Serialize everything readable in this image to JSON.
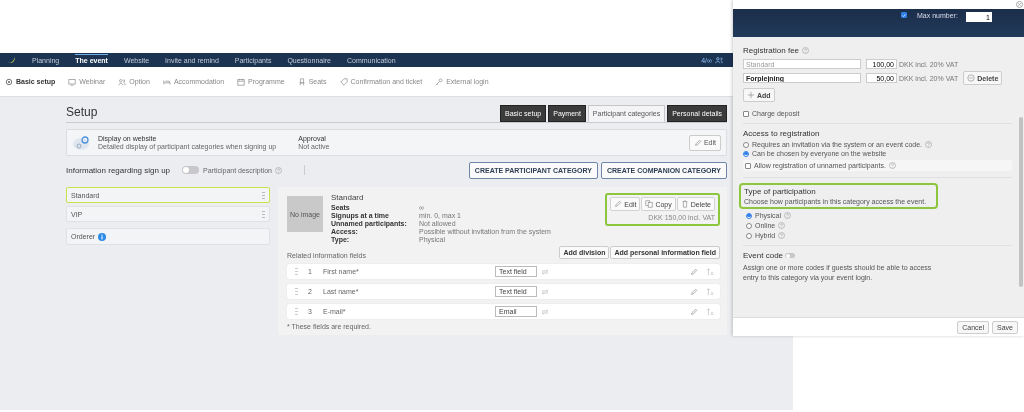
{
  "app": {
    "nav": {
      "items": [
        {
          "label": "Planning",
          "selected": false
        },
        {
          "label": "The event",
          "selected": true
        },
        {
          "label": "Website",
          "selected": false
        },
        {
          "label": "Invite and remind",
          "selected": false
        },
        {
          "label": "Participants",
          "selected": false
        },
        {
          "label": "Questionnaire",
          "selected": false
        },
        {
          "label": "Communication",
          "selected": false
        }
      ],
      "counter": "4/∞"
    },
    "subnav": [
      {
        "label": "Basic setup",
        "selected": true
      },
      {
        "label": "Webinar",
        "selected": false
      },
      {
        "label": "Option",
        "selected": false
      },
      {
        "label": "Accommodation",
        "selected": false
      },
      {
        "label": "Programme",
        "selected": false
      },
      {
        "label": "Seats",
        "selected": false
      },
      {
        "label": "Confirmation and ticket",
        "selected": false
      },
      {
        "label": "External login",
        "selected": false
      }
    ],
    "page": {
      "title": "Setup",
      "tabs": [
        {
          "label": "Basic setup",
          "selected": false
        },
        {
          "label": "Payment",
          "selected": false
        },
        {
          "label": "Participant categories",
          "selected": true
        },
        {
          "label": "Personal details",
          "selected": false
        }
      ]
    },
    "display_card": {
      "title": "Display on website",
      "description": "Detailed display of participant categories when signing up",
      "approval_label": "Approval",
      "approval_value": "Not active",
      "edit": "Edit"
    },
    "signup": {
      "title": "Information regarding sign up",
      "toggle": {
        "label": "Participant description",
        "on": false
      },
      "buttons": [
        "CREATE PARTICIPANT CATEGORY",
        "CREATE COMPANION CATEGORY"
      ]
    },
    "categories": [
      {
        "name": "Standard",
        "selected": true,
        "kind": "category"
      },
      {
        "name": "VIP",
        "selected": false,
        "kind": "category"
      },
      {
        "name": "Orderer",
        "selected": false,
        "kind": "orderer"
      }
    ],
    "detail": {
      "image": "No image",
      "title": "Standard",
      "properties": [
        {
          "label": "Seats",
          "value": "∞"
        },
        {
          "label": "Signups at a time",
          "value": "min. 0, max 1"
        },
        {
          "label": "Unnamed participants:",
          "value": "Not allowed"
        },
        {
          "label": "Access:",
          "value": "Possible without invitation from the system"
        },
        {
          "label": "Type:",
          "value": "Physical"
        }
      ],
      "actions": [
        "Edit",
        "Copy",
        "Delete"
      ],
      "price": "DKK 150,00 incl. VAT",
      "fields_title": "Related information fields",
      "field_buttons": [
        "Add division",
        "Add personal information field"
      ],
      "fields": [
        {
          "number": "1",
          "name": "First name*",
          "type": "Text field"
        },
        {
          "number": "2",
          "name": "Last name*",
          "type": "Text field"
        },
        {
          "number": "3",
          "name": "E-mail*",
          "type": "Email"
        }
      ],
      "note": "* These fields are required."
    }
  },
  "dialog": {
    "header": {
      "checked": true,
      "max_label": "Max number:",
      "max_value": "1"
    },
    "fee": {
      "title": "Registration fee",
      "rows": [
        {
          "placeholder": "Standard",
          "amount": "100,00",
          "currency": "DKK incl. 20% VAT"
        },
        {
          "name": "Forplejning",
          "amount": "50,00",
          "currency": "DKK incl. 20% VAT",
          "delete": "Delete"
        }
      ],
      "add": "Add"
    },
    "deposit": {
      "label": "Charge deposit",
      "checked": false
    },
    "access": {
      "title": "Access to registration",
      "options": [
        {
          "label": "Requires an invitation via the system or an event code.",
          "selected": false,
          "help": true
        },
        {
          "label": "Can be chosen by everyone on the website",
          "selected": true,
          "help": false
        }
      ],
      "unnamed": {
        "label": "Allow registration of unnamed participants.",
        "checked": false
      }
    },
    "participation": {
      "title": "Type of participation",
      "description": "Choose how participants in this category access the event.",
      "options": [
        {
          "label": "Physical",
          "selected": true
        },
        {
          "label": "Online",
          "selected": false
        },
        {
          "label": "Hybrid",
          "selected": false
        }
      ]
    },
    "event_code": {
      "title": "Event code",
      "on": false,
      "description": "Assign one or more codes if guests should be able to access entry to this category via your event login."
    },
    "buttons": [
      "Cancel",
      "Save"
    ]
  }
}
